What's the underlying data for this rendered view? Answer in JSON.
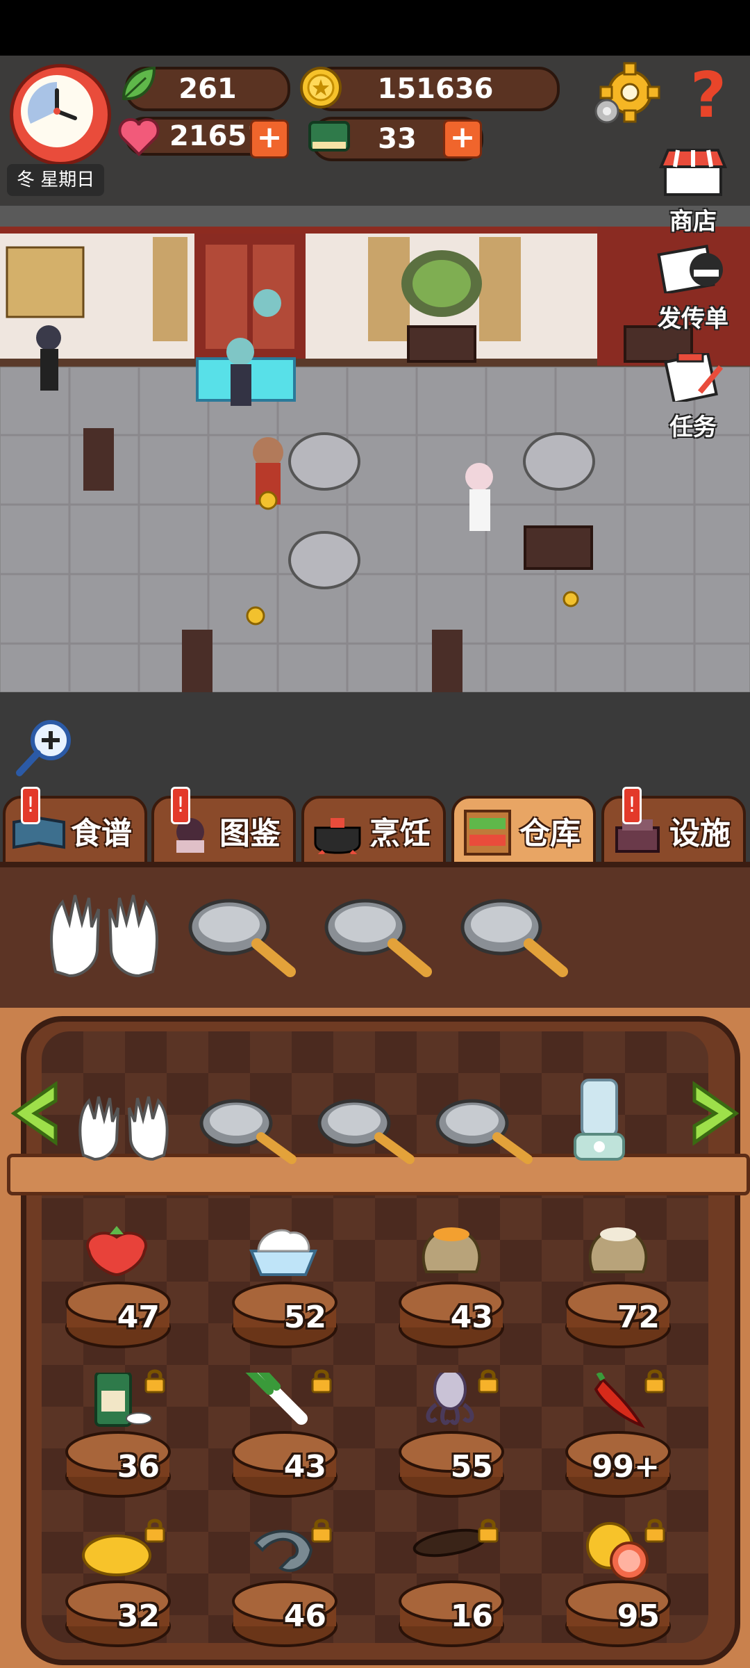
{
  "hud": {
    "season_day": "冬 星期日",
    "leaves": "261",
    "coins": "151636",
    "hearts": "21651",
    "books": "33",
    "help": "?"
  },
  "side": {
    "shop": "商店",
    "flyer": "发传单",
    "tasks": "任务"
  },
  "tabs": [
    {
      "label": "食谱",
      "alert": "!"
    },
    {
      "label": "图鉴",
      "alert": "!"
    },
    {
      "label": "烹饪",
      "alert": ""
    },
    {
      "label": "仓库",
      "alert": ""
    },
    {
      "label": "设施",
      "alert": "!"
    }
  ],
  "active_tab": 3,
  "storage": {
    "row1": [
      "47",
      "52",
      "43",
      "72"
    ],
    "row2": [
      "36",
      "43",
      "55",
      "99+"
    ],
    "row3": [
      "32",
      "46",
      "16",
      "95"
    ]
  },
  "ingredients": {
    "row1": [
      "strawberry-icon",
      "cream-icon",
      "grain-sack-icon",
      "flour-sack-icon"
    ],
    "row2": [
      "tea-can-icon",
      "leek-icon",
      "squid-icon",
      "chili-icon"
    ],
    "row3": [
      "mango-icon",
      "shrimp-icon",
      "sea-cucumber-icon",
      "grapefruit-icon"
    ]
  },
  "colors": {
    "accent": "#f0652c",
    "wood": "#c9814d"
  }
}
